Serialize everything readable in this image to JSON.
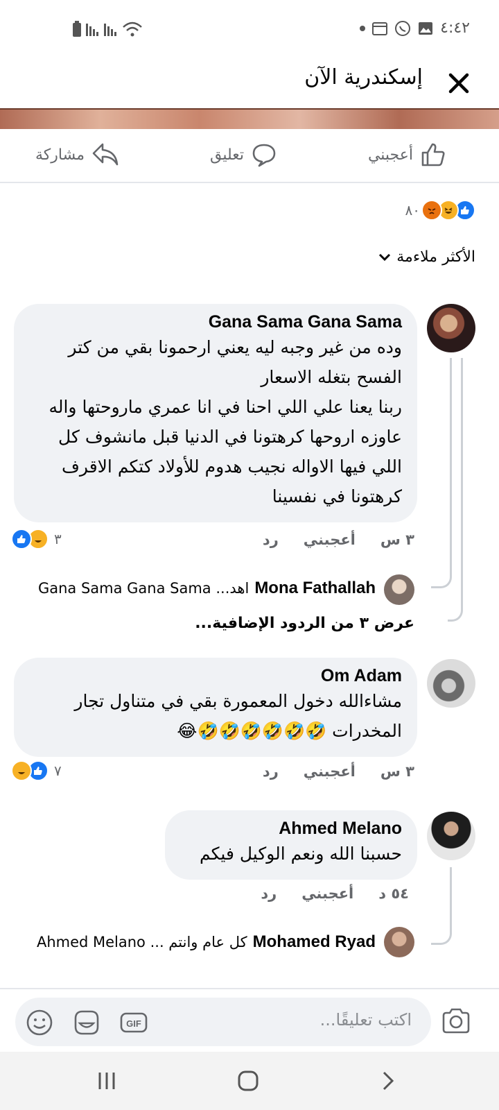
{
  "status_bar": {
    "time": "٤:٤٢"
  },
  "header": {
    "title": "إسكندرية الآن"
  },
  "actions": {
    "like": "أعجبني",
    "comment": "تعليق",
    "share": "مشاركة"
  },
  "reactions_summary": {
    "count": "٨٠",
    "icons": [
      "like-icon",
      "haha-icon",
      "angry-icon"
    ]
  },
  "sort": {
    "label": "الأكثر ملاءمة"
  },
  "comments": [
    {
      "author": "Gana Sama Gana Sama",
      "text": "وده من غير وجبه ليه يعني ارحمونا بقي من كتر الفسح بتغله الاسعار\nربنا يعنا علي اللي احنا في انا عمري ماروحتها واله عاوزه اروحها كرهتونا في الدنيا قبل مانشوف كل اللي فيها الاواله نجيب هدوم للأولاد كتكم الاقرف كرهتونا في نفسينا",
      "time": "٣ س",
      "like": "أعجبني",
      "reply": "رد",
      "reactions_count": "٣",
      "reply_preview": {
        "author": "Mona Fathallah",
        "snippet": "اهد... Gana Sama Gana Sama"
      },
      "more_replies": "عرض ٣ من الردود الإضافية..."
    },
    {
      "author": "Om Adam",
      "text": "مشاءالله دخول المعمورة بقي في متناول تجار المخدرات 🤣🤣🤣🤣🤣🤣😂",
      "time": "٣ س",
      "like": "أعجبني",
      "reply": "رد",
      "reactions_count": "٧"
    },
    {
      "author": "Ahmed Melano",
      "text": "حسبنا الله ونعم الوكيل فيكم",
      "time": "٥٤ د",
      "like": "أعجبني",
      "reply": "رد",
      "reply_preview": {
        "author": "Mohamed Ryad",
        "snippet": "كل عام وانتم ... Ahmed Melano"
      }
    }
  ],
  "composer": {
    "placeholder": "اكتب تعليقًا..."
  },
  "colors": {
    "facebook_blue": "#1877f2",
    "haha_yellow": "#f7b125",
    "bubble_bg": "#f0f2f5",
    "meta_gray": "#65676b"
  }
}
